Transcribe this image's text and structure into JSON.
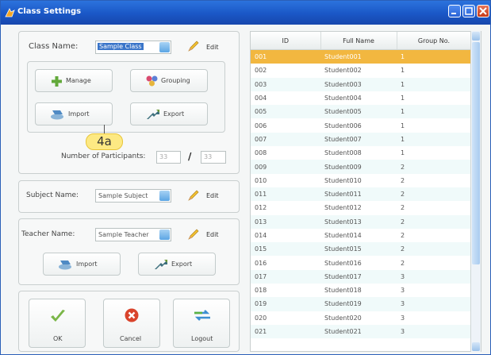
{
  "window": {
    "title": "Class Settings"
  },
  "class_group": {
    "class_name_label": "Class Name:",
    "class_name_value": "Sample Class",
    "edit_label": "Edit",
    "manage_label": "Manage",
    "grouping_label": "Grouping",
    "import_label": "Import",
    "export_label": "Export",
    "participants_label": "Number of Participants:",
    "participants_current": "33",
    "participants_separator": "/",
    "participants_total": "33"
  },
  "callout": {
    "text": "4a"
  },
  "subject_group": {
    "subject_name_label": "Subject Name:",
    "subject_name_value": "Sample Subject",
    "edit_label": "Edit"
  },
  "teacher_group": {
    "teacher_name_label": "Teacher Name:",
    "teacher_name_value": "Sample Teacher",
    "edit_label": "Edit",
    "import_label": "Import",
    "export_label": "Export"
  },
  "actions": {
    "ok_label": "OK",
    "cancel_label": "Cancel",
    "logout_label": "Logout"
  },
  "table": {
    "columns": [
      "ID",
      "Full Name",
      "Group No."
    ],
    "selected_row": 0,
    "rows": [
      [
        "001",
        "Student001",
        "1"
      ],
      [
        "002",
        "Student002",
        "1"
      ],
      [
        "003",
        "Student003",
        "1"
      ],
      [
        "004",
        "Student004",
        "1"
      ],
      [
        "005",
        "Student005",
        "1"
      ],
      [
        "006",
        "Student006",
        "1"
      ],
      [
        "007",
        "Student007",
        "1"
      ],
      [
        "008",
        "Student008",
        "1"
      ],
      [
        "009",
        "Student009",
        "2"
      ],
      [
        "010",
        "Student010",
        "2"
      ],
      [
        "011",
        "Student011",
        "2"
      ],
      [
        "012",
        "Student012",
        "2"
      ],
      [
        "013",
        "Student013",
        "2"
      ],
      [
        "014",
        "Student014",
        "2"
      ],
      [
        "015",
        "Student015",
        "2"
      ],
      [
        "016",
        "Student016",
        "2"
      ],
      [
        "017",
        "Student017",
        "3"
      ],
      [
        "018",
        "Student018",
        "3"
      ],
      [
        "019",
        "Student019",
        "3"
      ],
      [
        "020",
        "Student020",
        "3"
      ],
      [
        "021",
        "Student021",
        "3"
      ]
    ]
  },
  "colors": {
    "title_bar": "#1a57c6",
    "selected_row": "#f2b740",
    "callout": "#fde983"
  }
}
